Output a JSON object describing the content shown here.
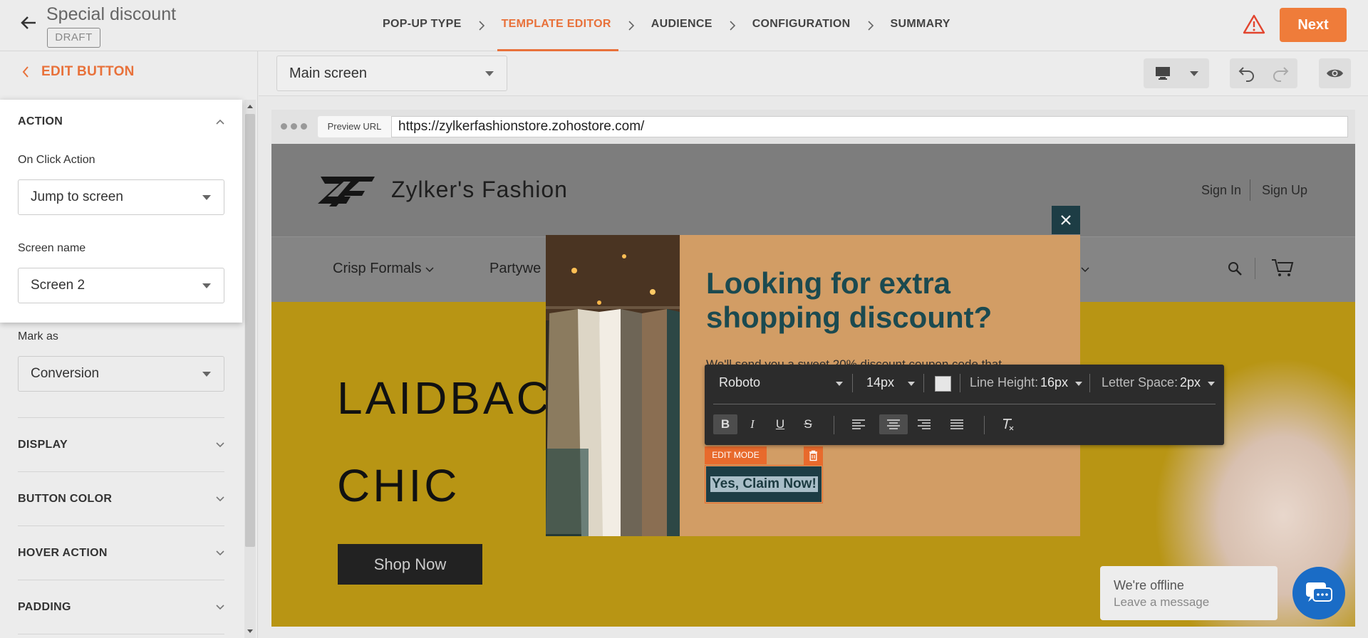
{
  "header": {
    "title": "Special discount",
    "status": "DRAFT",
    "steps": [
      "POP-UP TYPE",
      "TEMPLATE EDITOR",
      "AUDIENCE",
      "CONFIGURATION",
      "SUMMARY"
    ],
    "active_step": "TEMPLATE EDITOR",
    "next_label": "Next"
  },
  "left": {
    "back_label": "EDIT BUTTON",
    "action_title": "ACTION",
    "on_click_label": "On Click Action",
    "on_click_value": "Jump to screen",
    "screen_name_label": "Screen name",
    "screen_name_value": "Screen 2",
    "mark_as_label": "Mark as",
    "mark_as_value": "Conversion",
    "sections": [
      "DISPLAY",
      "BUTTON COLOR",
      "HOVER ACTION",
      "PADDING"
    ]
  },
  "editor": {
    "screen_select": "Main screen",
    "preview_label": "Preview URL",
    "preview_url": "https://zylkerfashionstore.zohostore.com/"
  },
  "site": {
    "brand": "Zylker's Fashion",
    "sign_in": "Sign In",
    "sign_up": "Sign Up",
    "nav": [
      "Crisp Formals",
      "Partywe",
      "e"
    ],
    "hero_line1": "LAIDBACK",
    "hero_line2": "CHIC",
    "shop_now": "Shop Now",
    "chat_title": "We're offline",
    "chat_sub": "Leave a message"
  },
  "popup": {
    "heading": "Looking for extra shopping discount?",
    "body": "We'll send you a sweet 20% discount coupon code that",
    "button_text": "Yes, Claim Now!",
    "edit_mode": "EDIT MODE"
  },
  "rte": {
    "font": "Roboto",
    "size": "14px",
    "line_height_label": "Line Height:",
    "line_height_value": "16px",
    "letter_space_label": "Letter Space:",
    "letter_space_value": "2px",
    "bold": "B",
    "italic": "I",
    "underline": "U",
    "strike": "S"
  },
  "colors": {
    "accent": "#e8713a",
    "popup_bg": "#d29d65",
    "popup_heading": "#1b4a50",
    "hero_bg": "#b89514"
  }
}
